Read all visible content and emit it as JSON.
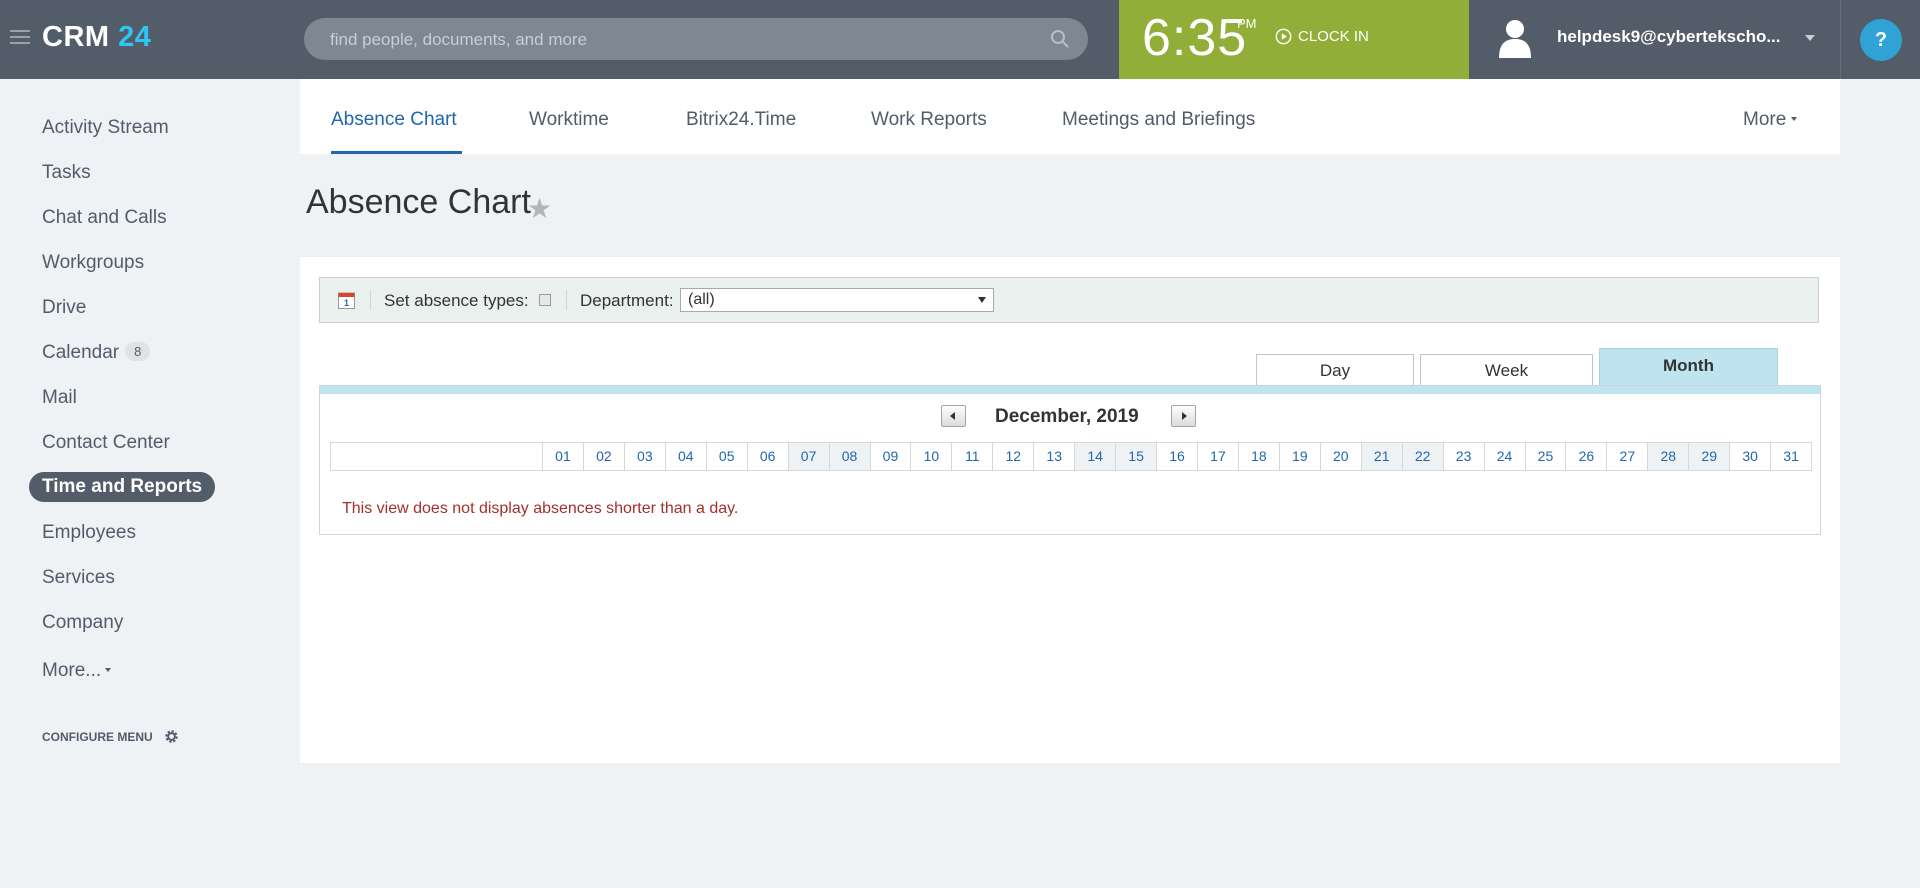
{
  "header": {
    "logo_text": "CRM",
    "logo_num": "24",
    "search_placeholder": "find people, documents, and more",
    "clock_time": "6:35",
    "clock_ampm": "PM",
    "clock_in_label": "CLOCK IN",
    "user_email": "helpdesk9@cybertekscho...",
    "help_label": "?",
    "colors": {
      "header_bg": "#535c69",
      "clock_bg": "#90ae38",
      "accent": "#2fc6f6",
      "help_bg": "#2fa3d6"
    }
  },
  "sidebar": {
    "items": [
      {
        "label": "Activity Stream"
      },
      {
        "label": "Tasks"
      },
      {
        "label": "Chat and Calls"
      },
      {
        "label": "Workgroups"
      },
      {
        "label": "Drive"
      },
      {
        "label": "Calendar",
        "badge": "8"
      },
      {
        "label": "Mail"
      },
      {
        "label": "Contact Center"
      },
      {
        "label": "Time and Reports",
        "active": true
      },
      {
        "label": "Employees"
      },
      {
        "label": "Services"
      },
      {
        "label": "Company"
      },
      {
        "label": "More..."
      }
    ],
    "configure_label": "CONFIGURE MENU"
  },
  "tabs": {
    "items": [
      {
        "label": "Absence Chart",
        "active": true
      },
      {
        "label": "Worktime"
      },
      {
        "label": "Bitrix24.Time"
      },
      {
        "label": "Work Reports"
      },
      {
        "label": "Meetings and Briefings"
      }
    ],
    "more_label": "More"
  },
  "page": {
    "title": "Absence Chart"
  },
  "toolbar": {
    "set_absence_label": "Set absence types:",
    "department_label": "Department:",
    "department_value": "(all)"
  },
  "view_tabs": {
    "day": "Day",
    "week": "Week",
    "month": "Month",
    "active": "month"
  },
  "calendar": {
    "month_label": "December, 2019",
    "days": [
      "01",
      "02",
      "03",
      "04",
      "05",
      "06",
      "07",
      "08",
      "09",
      "10",
      "11",
      "12",
      "13",
      "14",
      "15",
      "16",
      "17",
      "18",
      "19",
      "20",
      "21",
      "22",
      "23",
      "24",
      "25",
      "26",
      "27",
      "28",
      "29",
      "30",
      "31"
    ],
    "weekend_days": [
      "07",
      "08",
      "14",
      "15",
      "21",
      "22",
      "28",
      "29"
    ],
    "notice": "This view does not display absences shorter than a day.",
    "colors": {
      "day_text": "#2067b0",
      "notice_text": "#a4302a",
      "month_tab_bg": "#bfe3ef"
    }
  }
}
